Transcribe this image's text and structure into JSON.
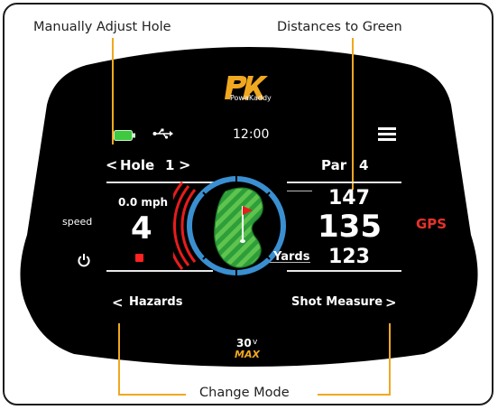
{
  "callouts": {
    "manual_adjust": "Manually Adjust Hole",
    "distances": "Distances to Green",
    "change_mode": "Change Mode"
  },
  "brand": {
    "name": "PowaKaddy",
    "model_main": "30",
    "model_sub": "v",
    "model_line2": "MAX"
  },
  "status": {
    "time": "12:00"
  },
  "hole": {
    "prev": "<",
    "label": "Hole",
    "number": "1",
    "next": ">"
  },
  "par": {
    "label": "Par",
    "number": "4"
  },
  "speed": {
    "value_text": "0.0 mph",
    "level": "4",
    "side_label": "speed"
  },
  "distances": {
    "back": "147",
    "middle": "135",
    "front": "123",
    "unit": "Yards"
  },
  "mode": {
    "gps": "GPS"
  },
  "nav": {
    "left_chevron": "<",
    "left": "Hazards",
    "right": "Shot Measure",
    "right_chevron": ">"
  },
  "colors": {
    "accent": "#f0a820",
    "gps": "#e5322b",
    "ring": "#3a8fd0",
    "green": "#2e9e3a",
    "battery": "#3ec93e",
    "stop": "#ff2222"
  },
  "icons": {
    "battery": "battery-icon",
    "usb": "usb-icon",
    "menu": "menu-icon",
    "power": "power-icon",
    "flag": "flag-icon"
  }
}
